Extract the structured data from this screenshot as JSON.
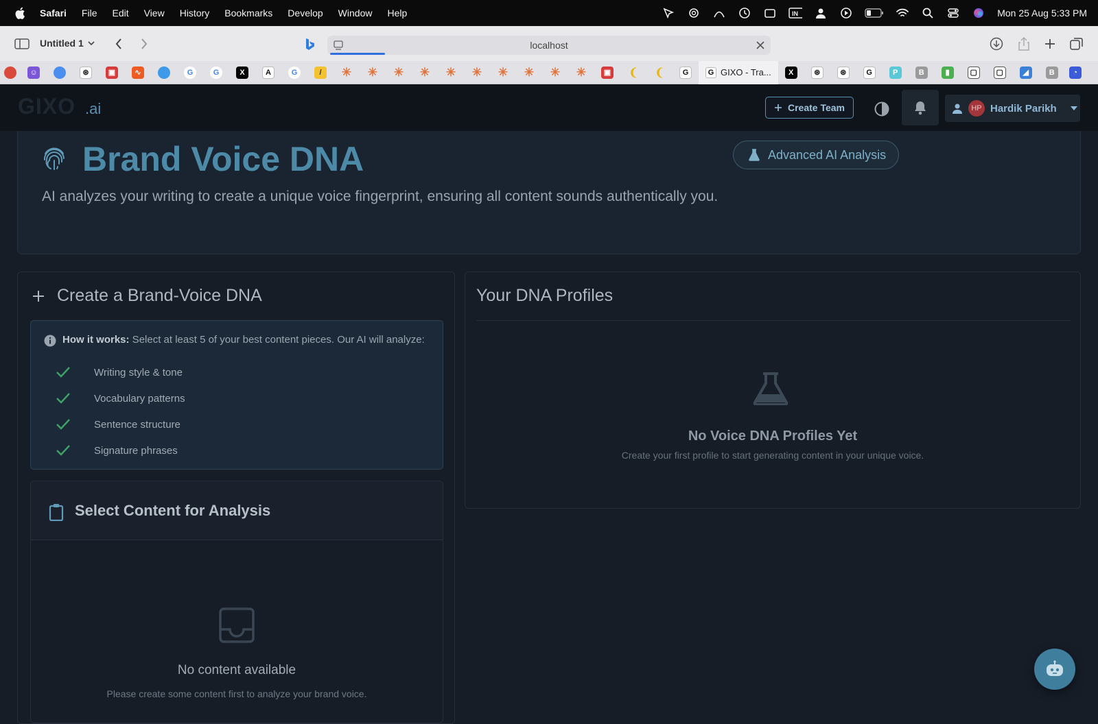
{
  "menubar": {
    "app": "Safari",
    "items": [
      "File",
      "Edit",
      "View",
      "History",
      "Bookmarks",
      "Develop",
      "Window",
      "Help"
    ],
    "clock": "Mon 25 Aug  5:33 PM"
  },
  "toolbar": {
    "tab_group": "Untitled 1",
    "url": "localhost"
  },
  "favorites": {
    "active_tab_label": "GIXO - Tra..."
  },
  "header": {
    "logo_mark": "GIXO",
    "logo_suffix": ".ai",
    "create_team": "Create Team",
    "user_initials": "HP",
    "user_name": "Hardik Parikh"
  },
  "hero": {
    "title": "Brand Voice DNA",
    "badge": "Advanced AI Analysis",
    "description": "AI analyzes your writing to create a unique voice fingerprint, ensuring all content sounds authentically you."
  },
  "create": {
    "title": "Create a Brand-Voice DNA",
    "how_label": "How it works:",
    "how_text": " Select at least 5 of your best content pieces. Our AI will analyze:",
    "features": [
      "Writing style & tone",
      "Vocabulary patterns",
      "Sentence structure",
      "Signature phrases"
    ]
  },
  "select": {
    "title": "Select Content for Analysis",
    "empty_title": "No content available",
    "empty_sub": "Please create some content first to analyze your brand voice."
  },
  "profiles": {
    "title": "Your DNA Profiles",
    "empty_title": "No Voice DNA Profiles Yet",
    "empty_sub": "Create your first profile to start generating content in your unique voice."
  },
  "colors": {
    "accent": "#4d8aa8",
    "background": "#161d27",
    "check": "#3fa266"
  }
}
